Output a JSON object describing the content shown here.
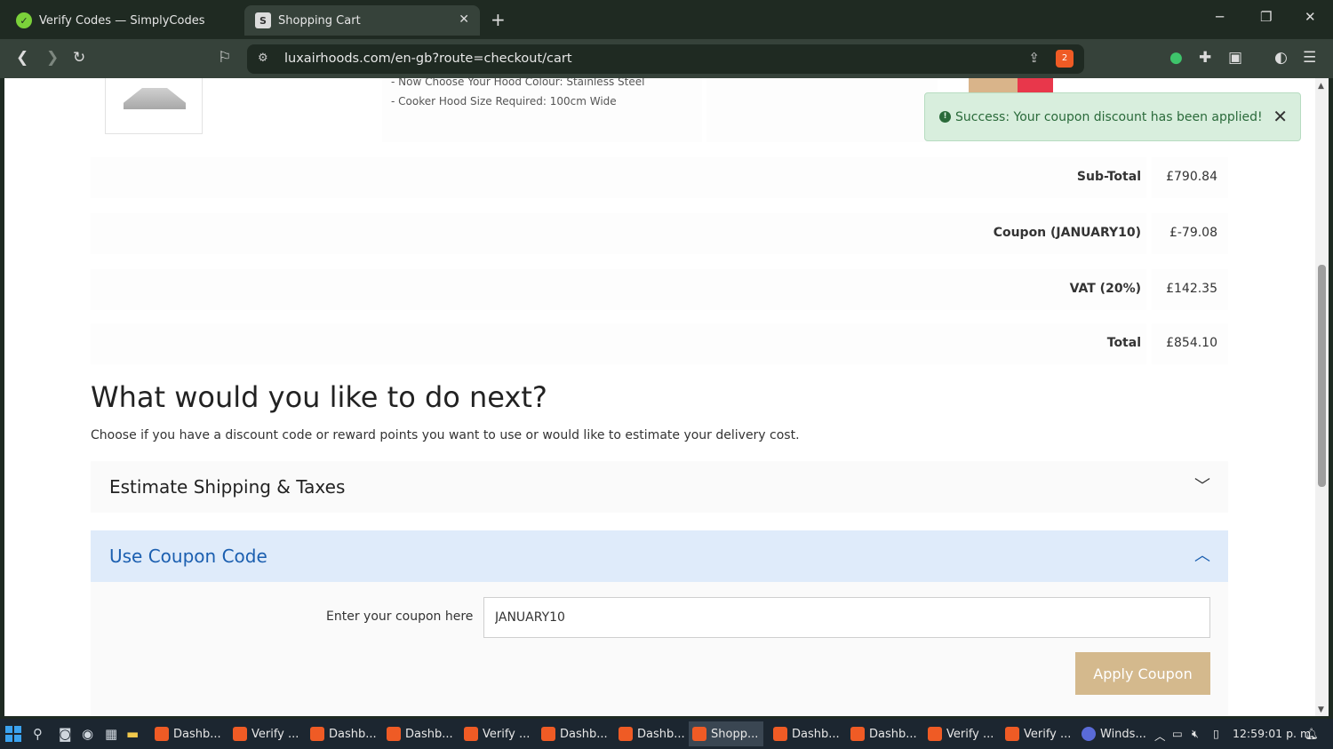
{
  "browser": {
    "tabs": [
      {
        "title": "Verify Codes — SimplyCodes"
      },
      {
        "title": "Shopping Cart"
      }
    ],
    "url": "luxairhoods.com/en-gb?route=checkout/cart",
    "brave_badge": "2"
  },
  "cart": {
    "options": [
      "- Now Choose Your Hood Colour: Stainless Steel",
      "- Cooker Hood Size Required: 100cm Wide"
    ],
    "alert": "Success: Your coupon discount has been applied!",
    "totals": [
      {
        "label": "Sub-Total",
        "value": "£790.84"
      },
      {
        "label": "Coupon (JANUARY10)",
        "value": "£-79.08"
      },
      {
        "label": "VAT (20%)",
        "value": "£142.35"
      },
      {
        "label": "Total",
        "value": "£854.10"
      }
    ]
  },
  "next": {
    "heading": "What would you like to do next?",
    "description": "Choose if you have a discount code or reward points you want to use or would like to estimate your delivery cost.",
    "shipping_title": "Estimate Shipping & Taxes",
    "coupon_title": "Use Coupon Code",
    "coupon_label": "Enter your coupon here",
    "coupon_value": "JANUARY10",
    "apply_label": "Apply Coupon"
  },
  "taskbar": {
    "items": [
      "Dashb...",
      "Verify ...",
      "Dashb...",
      "Dashb...",
      "Verify ...",
      "Dashb...",
      "Dashb...",
      "Shopp...",
      "Dashb...",
      "Dashb...",
      "Verify ...",
      "Verify ...",
      "Winds..."
    ],
    "clock": "12:59:01 p. m."
  }
}
